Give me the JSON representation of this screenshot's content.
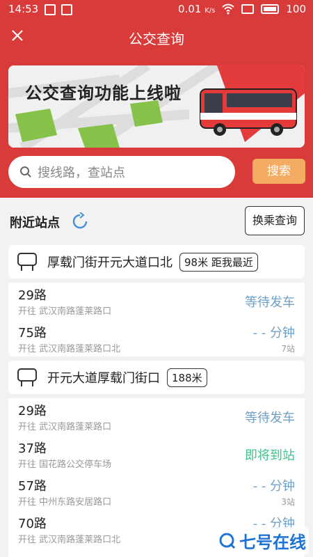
{
  "status_bar": {
    "time": "14:53",
    "speed": "0.01",
    "speed_unit": "K/s",
    "battery": "100"
  },
  "nav": {
    "title": "公交查询"
  },
  "banner": {
    "title": "公交查询功能上线啦"
  },
  "search": {
    "placeholder": "搜线路，查站点",
    "button": "搜索"
  },
  "nearby": {
    "title": "附近站点",
    "transfer_button": "换乘查询"
  },
  "stations": [
    {
      "name": "厚载门街开元大道口北",
      "distance": "98米  距我最近",
      "routes": [
        {
          "name": "29路",
          "direction": "开往 武汉南路蓬莱路口",
          "status": "等待发车",
          "sub": ""
        },
        {
          "name": "75路",
          "direction": "开往 武汉南路蓬莱路口北",
          "status": "- - 分钟",
          "sub": "7站"
        }
      ]
    },
    {
      "name": "开元大道厚载门街口",
      "distance": "188米",
      "routes": [
        {
          "name": "29路",
          "direction": "开往 武汉南路蓬莱路口",
          "status": "等待发车",
          "sub": ""
        },
        {
          "name": "37路",
          "direction": "开往 国花路公交停车场",
          "status": "即将到站",
          "sub": ""
        },
        {
          "name": "57路",
          "direction": "开往 中州东路安居路口",
          "status": "- - 分钟",
          "sub": "3站"
        },
        {
          "name": "70路",
          "direction": "开往 武汉南路蓬莱路口北",
          "status": "- - 分钟",
          "sub": ""
        }
      ]
    }
  ],
  "watermark": {
    "text": "七号在线"
  },
  "colors": {
    "primary": "#d93a3a",
    "search_btn": "#f3ac62",
    "wait": "#6fa0c8",
    "arrive": "#3ec48b",
    "watermark": "#1f73d6"
  }
}
